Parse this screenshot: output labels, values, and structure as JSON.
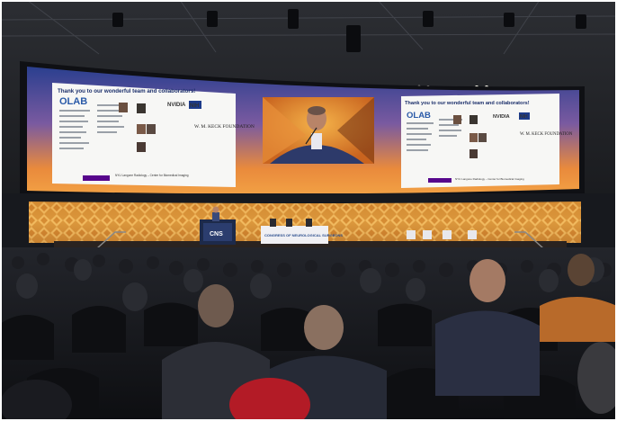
{
  "left_slide": {
    "title": "Thank you to our wonderful team and collaborators!",
    "org_logo": "OLAB",
    "partner_logos": [
      "NVIDIA",
      "NIH",
      "W. M. KECK FOUNDATION"
    ],
    "footer": "NYU Langone Radiology – Center for Biomedical Imaging"
  },
  "right_slide": {
    "title": "Thank you to our wonderful team and collaborators!",
    "org_logo": "OLAB",
    "partner_logos": [
      "NVIDIA",
      "NIH",
      "W. M. KECK FOUNDATION"
    ],
    "footer": "NYU Langone Radiology – Center for Biomedical Imaging"
  },
  "podium_logo": "CNS",
  "stage_banner": "CONGRESS OF NEUROLOGICAL SURGEONS",
  "colors": {
    "screen_orange": "#f08a2c",
    "screen_blue": "#2d3f8c",
    "stage_gold": "#e3a03a",
    "hall_dark": "#15171c"
  }
}
